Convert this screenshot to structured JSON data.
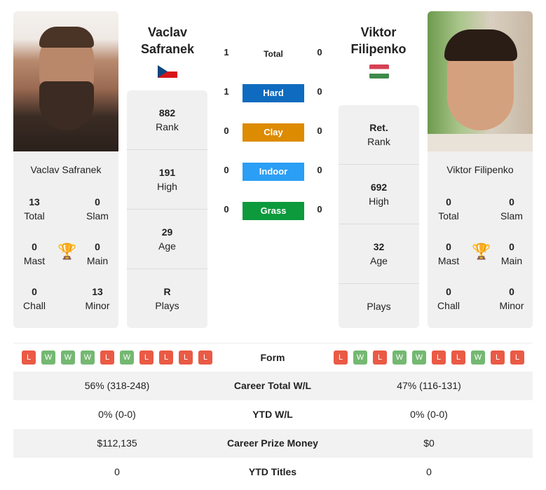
{
  "player1": {
    "name": "Vaclav Safranek",
    "header_name_line1": "Vaclav",
    "header_name_line2": "Safranek",
    "flag": "czech-republic",
    "total": "13",
    "total_label": "Total",
    "slam": "0",
    "slam_label": "Slam",
    "mast": "0",
    "mast_label": "Mast",
    "main": "0",
    "main_label": "Main",
    "chall": "0",
    "chall_label": "Chall",
    "minor": "13",
    "minor_label": "Minor",
    "stats": [
      {
        "value": "882",
        "label": "Rank"
      },
      {
        "value": "191",
        "label": "High"
      },
      {
        "value": "29",
        "label": "Age"
      },
      {
        "value": "R",
        "label": "Plays"
      }
    ],
    "form": [
      "L",
      "W",
      "W",
      "W",
      "L",
      "W",
      "L",
      "L",
      "L",
      "L"
    ]
  },
  "player2": {
    "name": "Viktor Filipenko",
    "header_name_line1": "Viktor",
    "header_name_line2": "Filipenko",
    "flag": "hungary",
    "total": "0",
    "total_label": "Total",
    "slam": "0",
    "slam_label": "Slam",
    "mast": "0",
    "mast_label": "Mast",
    "main": "0",
    "main_label": "Main",
    "chall": "0",
    "chall_label": "Chall",
    "minor": "0",
    "minor_label": "Minor",
    "stats": [
      {
        "value": "Ret.",
        "label": "Rank"
      },
      {
        "value": "692",
        "label": "High"
      },
      {
        "value": "32",
        "label": "Age"
      },
      {
        "value": "",
        "label": "Plays"
      }
    ],
    "form": [
      "L",
      "W",
      "L",
      "W",
      "W",
      "L",
      "L",
      "W",
      "L",
      "L"
    ]
  },
  "h2h": [
    {
      "label": "Total",
      "p1": "1",
      "p2": "0"
    },
    {
      "label": "Hard",
      "p1": "1",
      "p2": "0",
      "color": "#0f6bbf"
    },
    {
      "label": "Clay",
      "p1": "0",
      "p2": "0",
      "color": "#dd8b00"
    },
    {
      "label": "Indoor",
      "p1": "0",
      "p2": "0",
      "color": "#2b9ef5"
    },
    {
      "label": "Grass",
      "p1": "0",
      "p2": "0",
      "color": "#0c9a3c"
    }
  ],
  "table": [
    {
      "label": "Form"
    },
    {
      "label": "Career Total W/L",
      "p1": "56% (318-248)",
      "p2": "47% (116-131)"
    },
    {
      "label": "YTD W/L",
      "p1": "0% (0-0)",
      "p2": "0% (0-0)"
    },
    {
      "label": "Career Prize Money",
      "p1": "$112,135",
      "p2": "$0"
    },
    {
      "label": "YTD Titles",
      "p1": "0",
      "p2": "0"
    }
  ]
}
